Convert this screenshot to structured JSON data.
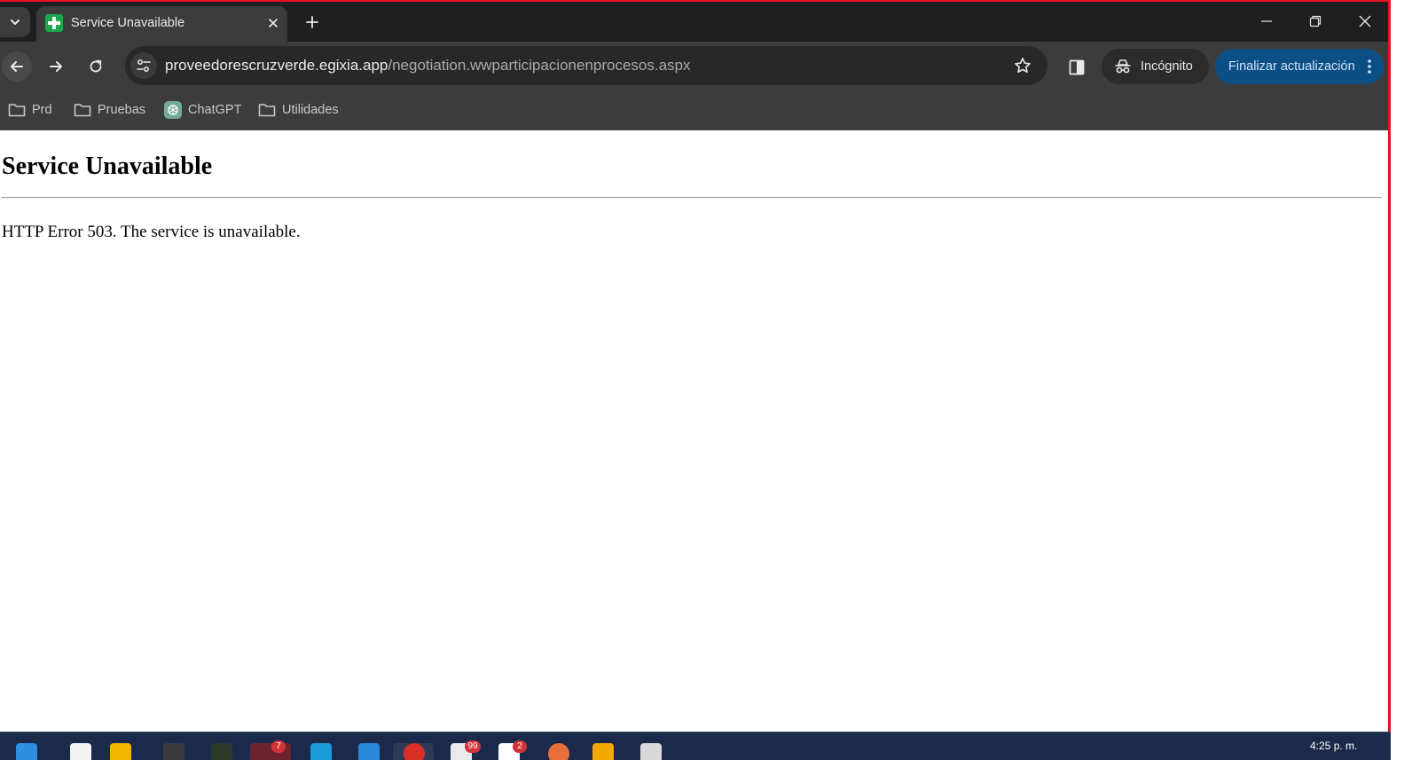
{
  "browser": {
    "tab": {
      "title": "Service Unavailable",
      "favicon": "green-cross-icon"
    },
    "address_bar": {
      "host": "proveedorescruzverde.egixia.app",
      "path": "/negotiation.wwparticipacionenprocesos.aspx"
    },
    "incognito_label": "Incógnito",
    "update_button_label": "Finalizar actualización",
    "bookmarks": [
      {
        "label": "Prd",
        "icon": "folder-icon"
      },
      {
        "label": "Pruebas",
        "icon": "folder-icon"
      },
      {
        "label": "ChatGPT",
        "icon": "chatgpt-icon"
      },
      {
        "label": "Utilidades",
        "icon": "folder-icon"
      }
    ],
    "colors": {
      "tabbar_bg": "#1f1f1f",
      "toolbar_bg": "#3c3c3c",
      "omnibox_bg": "#282828",
      "update_button_bg": "#0b4f85",
      "favicon_green": "#1ba94c",
      "window_border": "#e81123"
    }
  },
  "page": {
    "heading": "Service Unavailable",
    "message": "HTTP Error 503. The service is unavailable."
  },
  "taskbar": {
    "badges": [
      "7",
      "99",
      "2"
    ],
    "clock": "4:25 p. m."
  }
}
